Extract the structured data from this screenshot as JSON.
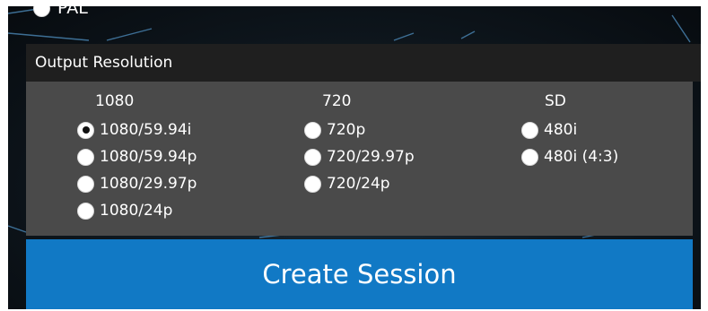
{
  "video_standard": {
    "option_label": "PAL"
  },
  "output_resolution": {
    "title": "Output Resolution",
    "columns": [
      {
        "heading": "1080",
        "options": [
          {
            "label": "1080/59.94i",
            "selected": true
          },
          {
            "label": "1080/59.94p",
            "selected": false
          },
          {
            "label": "1080/29.97p",
            "selected": false
          },
          {
            "label": "1080/24p",
            "selected": false
          }
        ]
      },
      {
        "heading": "720",
        "options": [
          {
            "label": "720p",
            "selected": false
          },
          {
            "label": "720/29.97p",
            "selected": false
          },
          {
            "label": "720/24p",
            "selected": false
          }
        ]
      },
      {
        "heading": "SD",
        "options": [
          {
            "label": "480i",
            "selected": false
          },
          {
            "label": "480i (4:3)",
            "selected": false
          }
        ]
      }
    ]
  },
  "create_button": {
    "label": "Create Session"
  },
  "colors": {
    "accent": "#1179c5",
    "panel": "#4a4a4a",
    "header": "#1f1f1f"
  }
}
